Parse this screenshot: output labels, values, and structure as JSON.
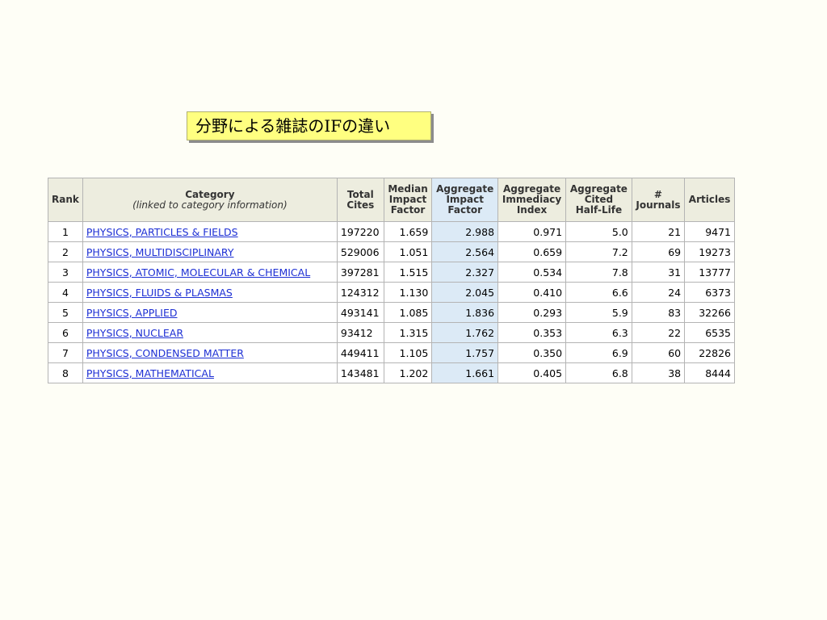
{
  "slide_title": "分野による雑誌のIFの違い",
  "table": {
    "headers": {
      "rank": "Rank",
      "category": "Category",
      "category_note": "(linked to category information)",
      "total_cites_1": "Total",
      "total_cites_2": "Cites",
      "median_if_1": "Median",
      "median_if_2": "Impact",
      "median_if_3": "Factor",
      "agg_if_1": "Aggregate",
      "agg_if_2": "Impact",
      "agg_if_3": "Factor",
      "agg_imm_1": "Aggregate",
      "agg_imm_2": "Immediacy",
      "agg_imm_3": "Index",
      "agg_hl_1": "Aggregate",
      "agg_hl_2": "Cited",
      "agg_hl_3": "Half-Life",
      "journals_1": "#",
      "journals_2": "Journals",
      "articles": "Articles"
    },
    "highlight_color": "#dceaf6",
    "link_color": "#1d2fd4",
    "rows": [
      {
        "rank": "1",
        "category": "PHYSICS, PARTICLES & FIELDS",
        "total_cites": "197220",
        "median_if": "1.659",
        "agg_if": "2.988",
        "agg_imm": "0.971",
        "agg_hl": "5.0",
        "journals": "21",
        "articles": "9471"
      },
      {
        "rank": "2",
        "category": "PHYSICS, MULTIDISCIPLINARY",
        "total_cites": "529006",
        "median_if": "1.051",
        "agg_if": "2.564",
        "agg_imm": "0.659",
        "agg_hl": "7.2",
        "journals": "69",
        "articles": "19273"
      },
      {
        "rank": "3",
        "category": "PHYSICS, ATOMIC, MOLECULAR & CHEMICAL",
        "total_cites": "397281",
        "median_if": "1.515",
        "agg_if": "2.327",
        "agg_imm": "0.534",
        "agg_hl": "7.8",
        "journals": "31",
        "articles": "13777"
      },
      {
        "rank": "4",
        "category": "PHYSICS, FLUIDS & PLASMAS",
        "total_cites": "124312",
        "median_if": "1.130",
        "agg_if": "2.045",
        "agg_imm": "0.410",
        "agg_hl": "6.6",
        "journals": "24",
        "articles": "6373"
      },
      {
        "rank": "5",
        "category": "PHYSICS, APPLIED",
        "total_cites": "493141",
        "median_if": "1.085",
        "agg_if": "1.836",
        "agg_imm": "0.293",
        "agg_hl": "5.9",
        "journals": "83",
        "articles": "32266"
      },
      {
        "rank": "6",
        "category": "PHYSICS, NUCLEAR",
        "total_cites": "93412",
        "median_if": "1.315",
        "agg_if": "1.762",
        "agg_imm": "0.353",
        "agg_hl": "6.3",
        "journals": "22",
        "articles": "6535"
      },
      {
        "rank": "7",
        "category": "PHYSICS, CONDENSED MATTER",
        "total_cites": "449411",
        "median_if": "1.105",
        "agg_if": "1.757",
        "agg_imm": "0.350",
        "agg_hl": "6.9",
        "journals": "60",
        "articles": "22826"
      },
      {
        "rank": "8",
        "category": "PHYSICS, MATHEMATICAL",
        "total_cites": "143481",
        "median_if": "1.202",
        "agg_if": "1.661",
        "agg_imm": "0.405",
        "agg_hl": "6.8",
        "journals": "38",
        "articles": "8444"
      }
    ]
  }
}
